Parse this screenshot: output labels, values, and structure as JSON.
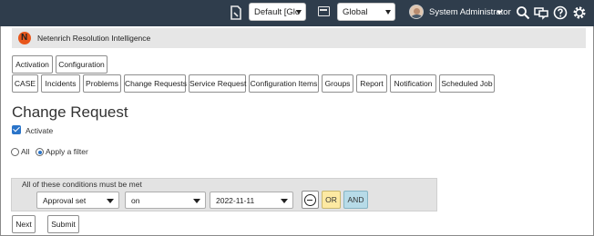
{
  "topbar": {
    "update_set": "Default [Glc",
    "scope": "Global",
    "user_name": "System Administrator",
    "icons": [
      "document-icon",
      "application-icon",
      "search-icon",
      "chat-icon",
      "help-icon",
      "gear-icon"
    ],
    "bg_color": "#2f3d4c"
  },
  "app_header": {
    "title": "Netenrich Resolution Intelligence",
    "logo": "netenrich-logo"
  },
  "top_tabs": [
    "Activation",
    "Configuration"
  ],
  "module_tabs": [
    "CASE",
    "Incidents",
    "Problems",
    "Change Requests",
    "Service Request",
    "Configuration Items",
    "Groups",
    "Report",
    "Notification",
    "Scheduled Job"
  ],
  "page": {
    "title": "Change Request",
    "activate_label": "Activate",
    "activate_checked": true,
    "radio_all": "All",
    "radio_filter": "Apply a filter",
    "selected_radio": "Apply a filter"
  },
  "conditions": {
    "heading": "All of these conditions must be met",
    "field": "Approval set",
    "operator": "on",
    "value": "2022-11-11",
    "or_label": "OR",
    "and_label": "AND",
    "or_color": "#fde9a2",
    "and_color": "#b7dbe8"
  },
  "footer": {
    "next_label": "Next",
    "submit_label": "Submit"
  }
}
